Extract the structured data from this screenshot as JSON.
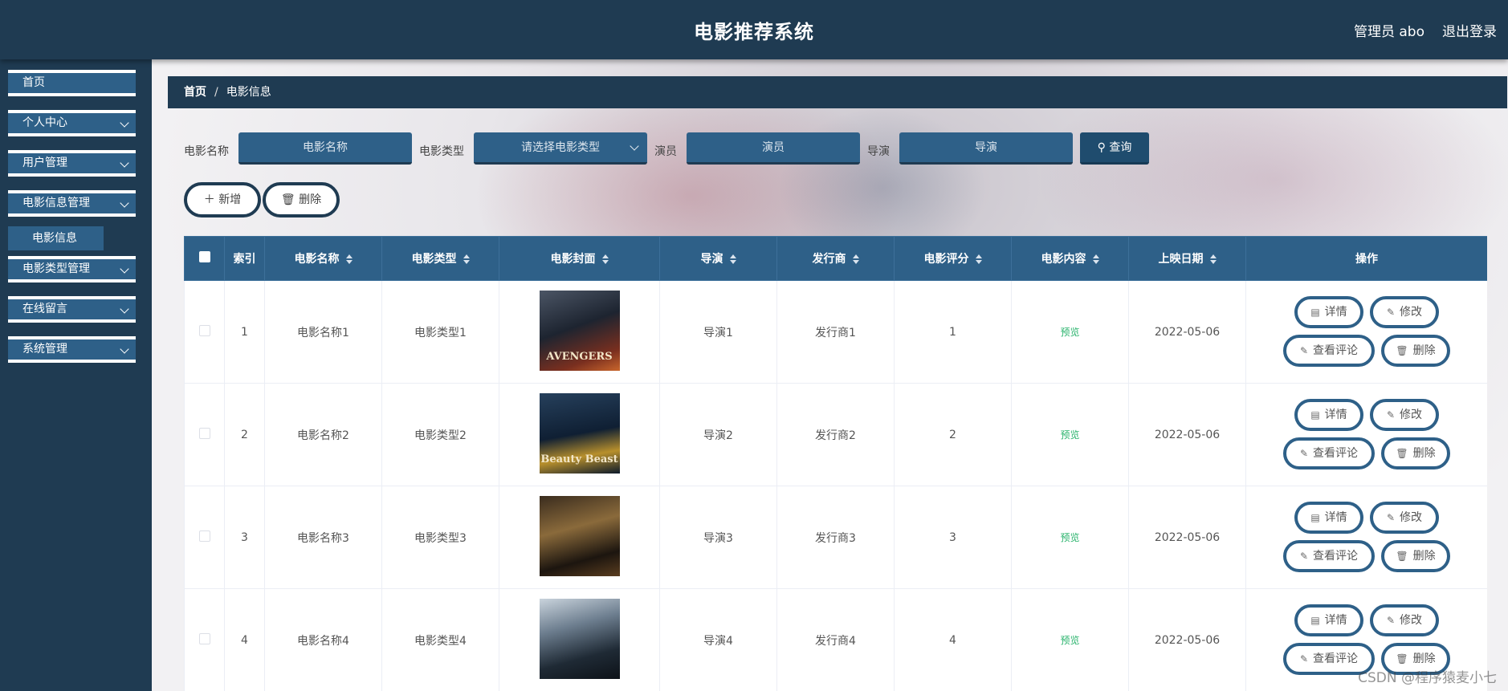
{
  "header": {
    "title": "电影推荐系统",
    "user": "管理员 abo",
    "logout": "退出登录"
  },
  "sidebar": {
    "items": [
      {
        "label": "首页"
      },
      {
        "label": "个人中心"
      },
      {
        "label": "用户管理"
      },
      {
        "label": "电影信息管理"
      },
      {
        "label": "电影类型管理"
      },
      {
        "label": "在线留言"
      },
      {
        "label": "系统管理"
      }
    ],
    "active_sub": "电影信息"
  },
  "breadcrumb": {
    "home": "首页",
    "separator": "/",
    "current": "电影信息"
  },
  "search": {
    "name_label": "电影名称",
    "name_placeholder": "电影名称",
    "type_label": "电影类型",
    "type_placeholder": "请选择电影类型",
    "actor_label": "演员",
    "actor_placeholder": "演员",
    "director_label": "导演",
    "director_placeholder": "导演",
    "query_button": "查询"
  },
  "actions": {
    "add": "新增",
    "delete": "删除"
  },
  "table": {
    "columns": [
      "索引",
      "电影名称",
      "电影类型",
      "电影封面",
      "导演",
      "发行商",
      "电影评分",
      "电影内容",
      "上映日期",
      "操作"
    ],
    "rows": [
      {
        "index": "1",
        "name": "电影名称1",
        "type": "电影类型1",
        "cover": "AVENGERS",
        "director": "导演1",
        "publisher": "发行商1",
        "rating": "1",
        "content": "预览",
        "date": "2022-05-06"
      },
      {
        "index": "2",
        "name": "电影名称2",
        "type": "电影类型2",
        "cover": "Beauty Beast",
        "director": "导演2",
        "publisher": "发行商2",
        "rating": "2",
        "content": "预览",
        "date": "2022-05-06"
      },
      {
        "index": "3",
        "name": "电影名称3",
        "type": "电影类型3",
        "cover": "",
        "director": "导演3",
        "publisher": "发行商3",
        "rating": "3",
        "content": "预览",
        "date": "2022-05-06"
      },
      {
        "index": "4",
        "name": "电影名称4",
        "type": "电影类型4",
        "cover": "",
        "director": "导演4",
        "publisher": "发行商4",
        "rating": "4",
        "content": "预览",
        "date": "2022-05-06"
      }
    ],
    "row_actions": {
      "detail": "详情",
      "edit": "修改",
      "comments": "查看评论",
      "delete": "删除"
    }
  },
  "watermark": "CSDN @程序猿麦小七",
  "colors": {
    "header_bg": "#1f3b52",
    "accent": "#2e6088",
    "preview_green": "#29b36c"
  }
}
